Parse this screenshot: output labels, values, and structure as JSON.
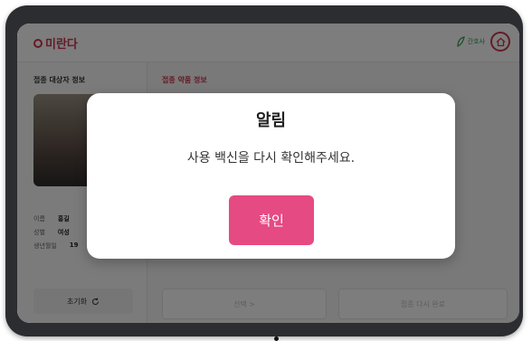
{
  "app": {
    "brand": "미란다",
    "brand_color": "#c8374f",
    "nurse_label": "간호사"
  },
  "sidebar": {
    "title": "접종 대상자 정보",
    "fields": [
      {
        "label": "이름",
        "value": "홍길"
      },
      {
        "label": "성별",
        "value": "여성"
      },
      {
        "label": "생년월일",
        "value": "19"
      }
    ],
    "reset_label": "초기화"
  },
  "main": {
    "section_title": "접종 약품 정보",
    "select_label": "선택 >",
    "complete_label": "접종 다시 완료"
  },
  "dialog": {
    "title": "알림",
    "message": "사용 백신을 다시 확인해주세요.",
    "confirm_label": "확인",
    "confirm_color": "#e64a82"
  }
}
